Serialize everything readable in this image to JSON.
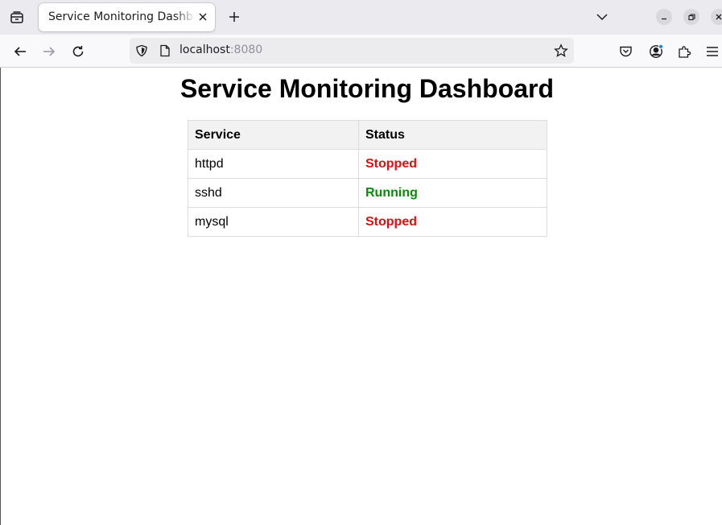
{
  "browser": {
    "tab_title": "Service Monitoring Dashboard",
    "url_host": "localhost",
    "url_port": ":8080"
  },
  "page": {
    "heading": "Service Monitoring Dashboard",
    "table": {
      "headers": [
        "Service",
        "Status"
      ],
      "rows": [
        {
          "service": "httpd",
          "status": "Stopped",
          "status_color": "#e01010"
        },
        {
          "service": "sshd",
          "status": "Running",
          "status_color": "#0a8a0a"
        },
        {
          "service": "mysql",
          "status": "Stopped",
          "status_color": "#e01010"
        }
      ]
    }
  },
  "icons": {
    "tab_overview": "tab-overview-icon",
    "tab_close": "close-icon",
    "new_tab": "plus-icon",
    "list_tabs": "chevron-down-icon",
    "back": "back-arrow-icon",
    "forward": "forward-arrow-icon",
    "reload": "reload-icon",
    "tracking": "shield-icon",
    "page_info": "page-icon",
    "bookmark": "star-icon",
    "pocket": "pocket-icon",
    "account": "account-icon",
    "extensions": "puzzle-icon",
    "menu": "hamburger-menu-icon"
  }
}
